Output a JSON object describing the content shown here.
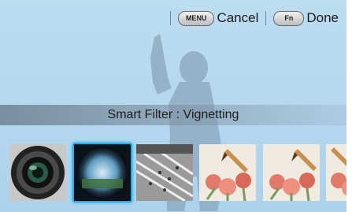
{
  "header": {
    "cancel_key": "MENU",
    "cancel_label": "Cancel",
    "done_key": "Fn",
    "done_label": "Done"
  },
  "banner": {
    "text": "Smart Filter : Vignetting"
  },
  "filters": [
    {
      "name": "lens",
      "selected": false
    },
    {
      "name": "vignetting",
      "selected": true
    },
    {
      "name": "miniature",
      "selected": false
    },
    {
      "name": "sketch",
      "selected": false
    },
    {
      "name": "sketch",
      "selected": false
    },
    {
      "name": "sketch",
      "selected": false
    }
  ],
  "colors": {
    "accent": "#22aee8",
    "background": "#b8d9ef"
  }
}
